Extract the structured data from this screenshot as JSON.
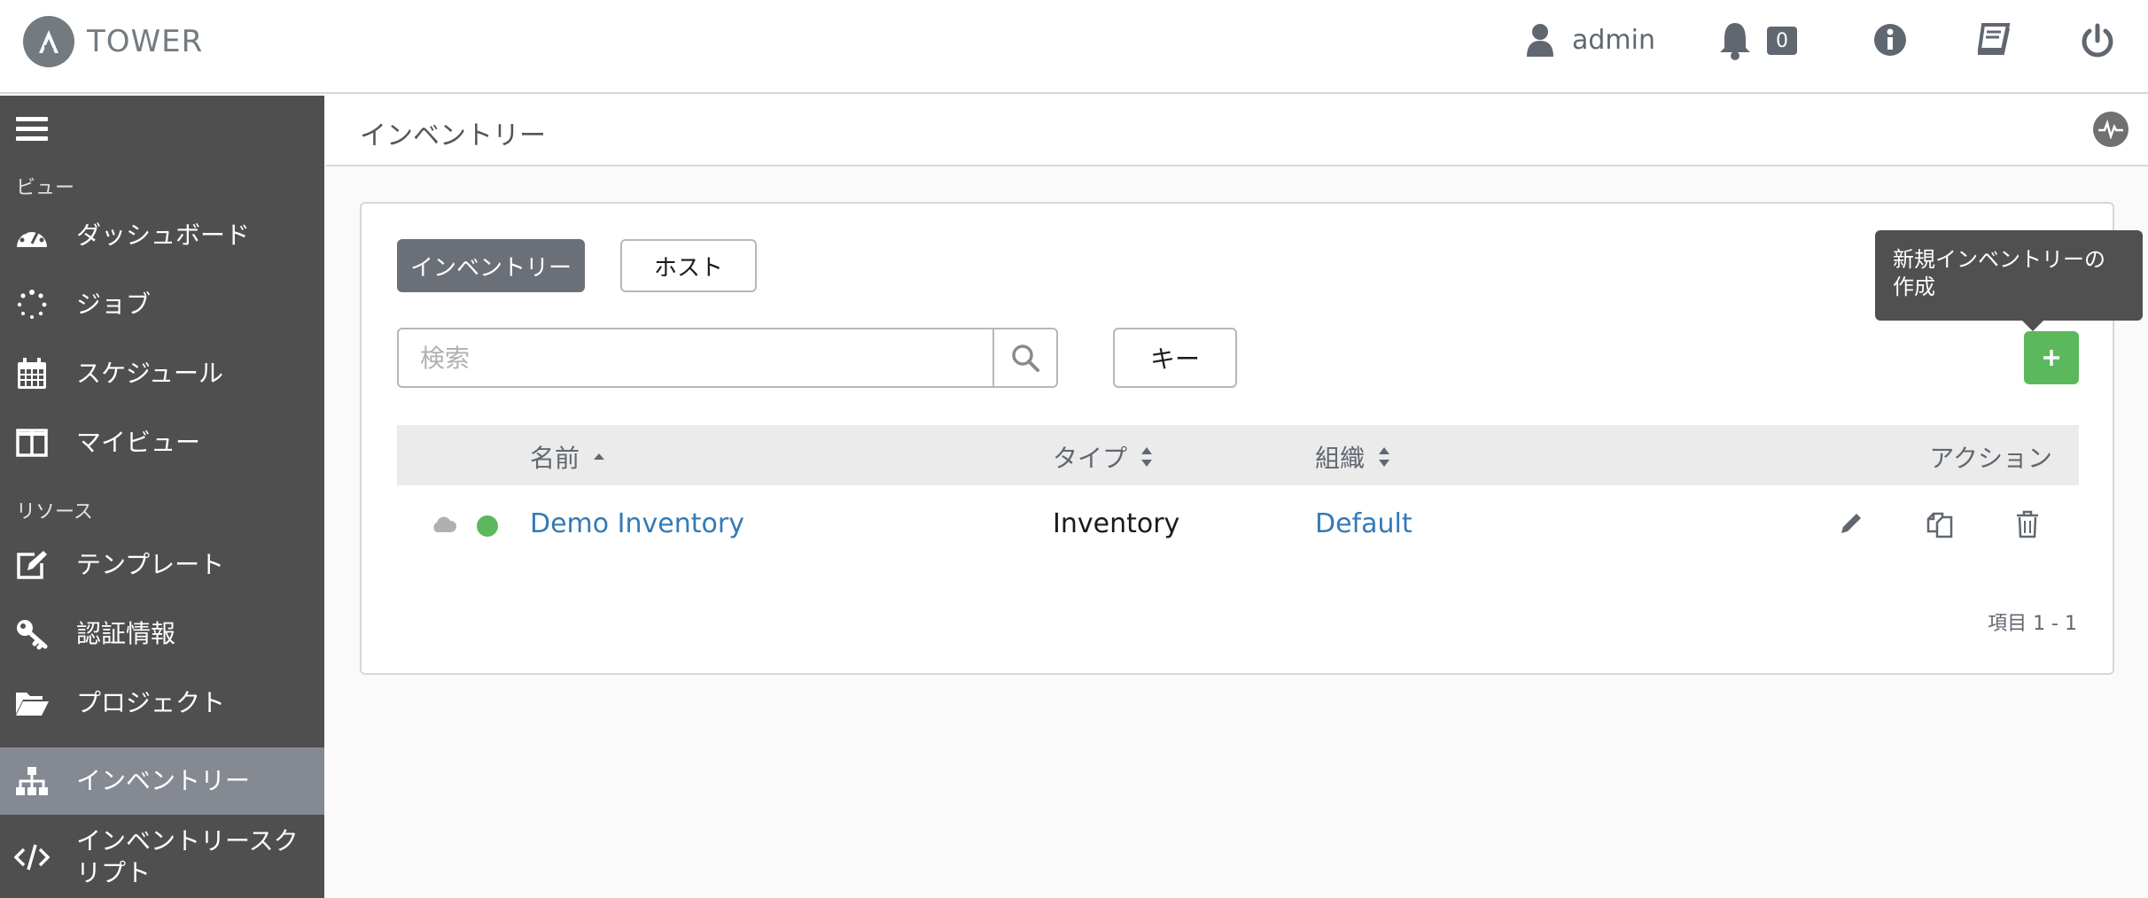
{
  "header": {
    "brand": "TOWER",
    "user": "admin",
    "notifications_count": "0"
  },
  "sidebar": {
    "views_label": "ビュー",
    "resources_label": "リソース",
    "items": [
      {
        "label": "ダッシュボード"
      },
      {
        "label": "ジョブ"
      },
      {
        "label": "スケジュール"
      },
      {
        "label": "マイビュー"
      },
      {
        "label": "テンプレート"
      },
      {
        "label": "認証情報"
      },
      {
        "label": "プロジェクト"
      },
      {
        "label": "インベントリー"
      },
      {
        "label": "インベントリースクリプト"
      }
    ]
  },
  "page": {
    "title": "インベントリー"
  },
  "tabs": {
    "inventories": "インベントリー",
    "hosts": "ホスト"
  },
  "search": {
    "placeholder": "検索",
    "key_button": "キー"
  },
  "tooltip": "新規インベントリーの作成",
  "table": {
    "columns": {
      "name": "名前",
      "type": "タイプ",
      "organization": "組織",
      "actions": "アクション"
    },
    "rows": [
      {
        "name": "Demo Inventory",
        "type": "Inventory",
        "organization": "Default"
      }
    ]
  },
  "pager": "項目  1 - 1",
  "colors": {
    "sidebar_bg": "#4f4f4f",
    "active_nav": "#848992",
    "accent_green": "#5cb85c",
    "link_blue": "#337ab7"
  }
}
